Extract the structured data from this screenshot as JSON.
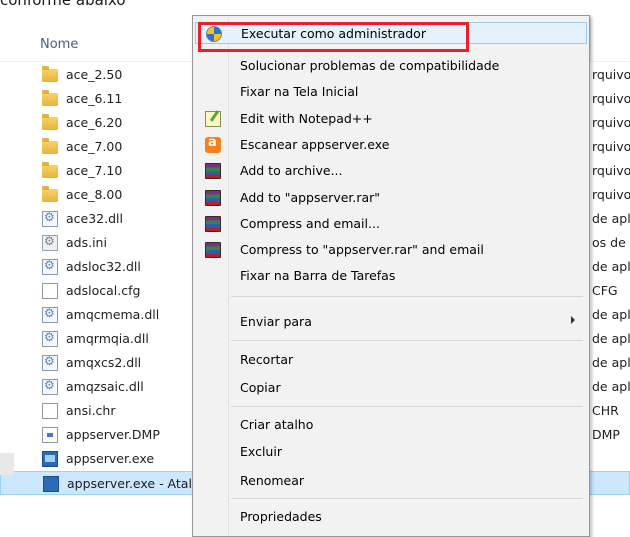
{
  "caption": "conforme abaixo",
  "explorer": {
    "column_header": "Nome",
    "files": [
      {
        "name": "ace_2.50",
        "icon": "folder-icon",
        "type_fragment": "rquivo"
      },
      {
        "name": "ace_6.11",
        "icon": "folder-icon",
        "type_fragment": "rquivo"
      },
      {
        "name": "ace_6.20",
        "icon": "folder-icon",
        "type_fragment": "rquivo"
      },
      {
        "name": "ace_7.00",
        "icon": "folder-icon",
        "type_fragment": "rquivo"
      },
      {
        "name": "ace_7.10",
        "icon": "folder-icon",
        "type_fragment": "rquivo"
      },
      {
        "name": "ace_8.00",
        "icon": "folder-icon",
        "type_fragment": "rquivo"
      },
      {
        "name": "ace32.dll",
        "icon": "dll-icon",
        "type_fragment": "de apl"
      },
      {
        "name": "ads.ini",
        "icon": "ini-icon",
        "type_fragment": "os de c"
      },
      {
        "name": "adsloc32.dll",
        "icon": "dll-icon",
        "type_fragment": "de apl"
      },
      {
        "name": "adslocal.cfg",
        "icon": "file-icon",
        "type_fragment": "CFG"
      },
      {
        "name": "amqcmema.dll",
        "icon": "dll-icon",
        "type_fragment": "de apl"
      },
      {
        "name": "amqrmqia.dll",
        "icon": "dll-icon",
        "type_fragment": "de apl"
      },
      {
        "name": "amqxcs2.dll",
        "icon": "dll-icon",
        "type_fragment": "de apl"
      },
      {
        "name": "amqzsaic.dll",
        "icon": "dll-icon",
        "type_fragment": "de apl"
      },
      {
        "name": "ansi.chr",
        "icon": "file-icon",
        "type_fragment": "CHR"
      },
      {
        "name": "appserver.DMP",
        "icon": "dmp-icon",
        "type_fragment": "DMP"
      },
      {
        "name": "appserver.exe",
        "icon": "exe-icon",
        "type_fragment": ""
      },
      {
        "name": "appserver.exe - Atalho",
        "icon": "shortcut-icon",
        "type_fragment": ""
      }
    ]
  },
  "context_menu": {
    "items": [
      {
        "label": "Executar como administrador",
        "icon": "uac-shield-icon",
        "highlighted": true
      },
      {
        "label": "Solucionar problemas de compatibilidade",
        "icon": ""
      },
      {
        "label": "Fixar na Tela Inicial",
        "icon": ""
      },
      {
        "label": "Edit with Notepad++",
        "icon": "notepad-plus-plus-icon"
      },
      {
        "label": "Escanear appserver.exe",
        "icon": "avast-icon"
      },
      {
        "label": "Add to archive...",
        "icon": "winrar-icon"
      },
      {
        "label": "Add to \"appserver.rar\"",
        "icon": "winrar-icon"
      },
      {
        "label": "Compress and email...",
        "icon": "winrar-icon"
      },
      {
        "label": "Compress to \"appserver.rar\" and email",
        "icon": "winrar-icon"
      },
      {
        "label": "Fixar na Barra de Tarefas",
        "icon": ""
      },
      {
        "label": "Enviar para",
        "icon": "",
        "submenu": true
      },
      {
        "label": "Recortar",
        "icon": ""
      },
      {
        "label": "Copiar",
        "icon": ""
      },
      {
        "label": "Criar atalho",
        "icon": ""
      },
      {
        "label": "Excluir",
        "icon": ""
      },
      {
        "label": "Renomear",
        "icon": ""
      },
      {
        "label": "Propriedades",
        "icon": ""
      }
    ]
  },
  "colors": {
    "highlight_border": "#e8202a",
    "hover_bg": "#e5f1fb",
    "selected_row_bg": "#cce8ff"
  }
}
